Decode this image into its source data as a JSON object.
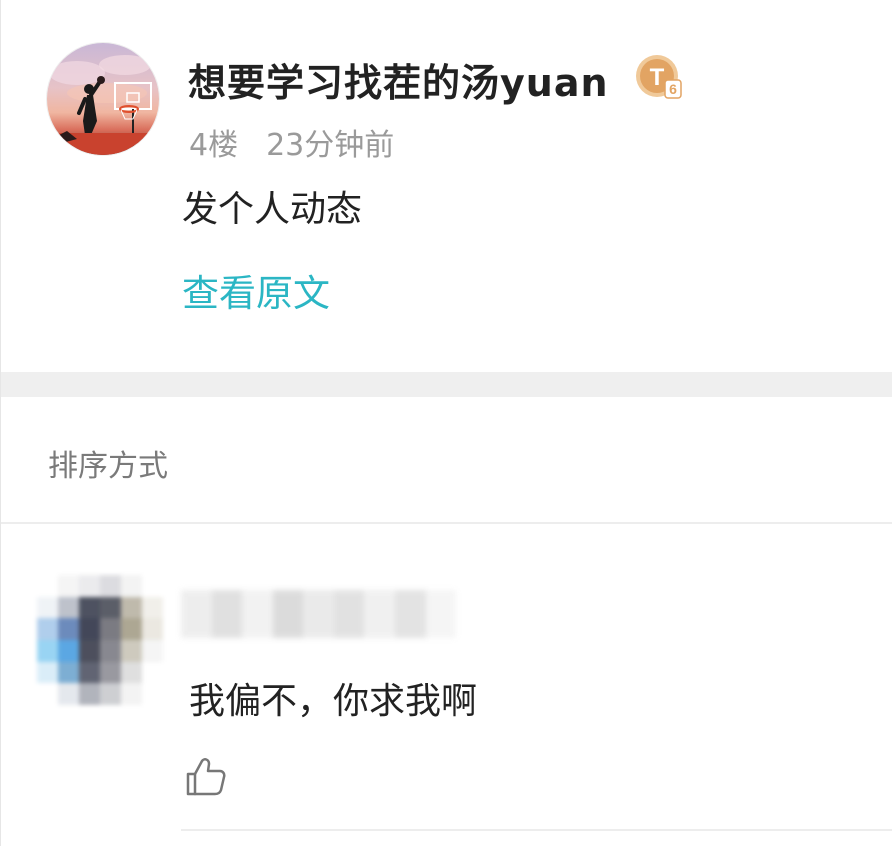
{
  "post": {
    "username": "想要学习找茬的汤yuan",
    "level_badge": {
      "letter": "T",
      "number": "6"
    },
    "floor": "4楼",
    "time": "23分钟前",
    "content": "发个人动态",
    "view_original_label": "查看原文"
  },
  "sort": {
    "label": "排序方式"
  },
  "comment": {
    "text": "我偏不，你求我啊"
  },
  "colors": {
    "link": "#2bb6c4",
    "badge": "#e2a463",
    "band": "#efefef"
  },
  "icons": {
    "like": "thumbs-up-icon",
    "level": "level-badge-icon"
  }
}
